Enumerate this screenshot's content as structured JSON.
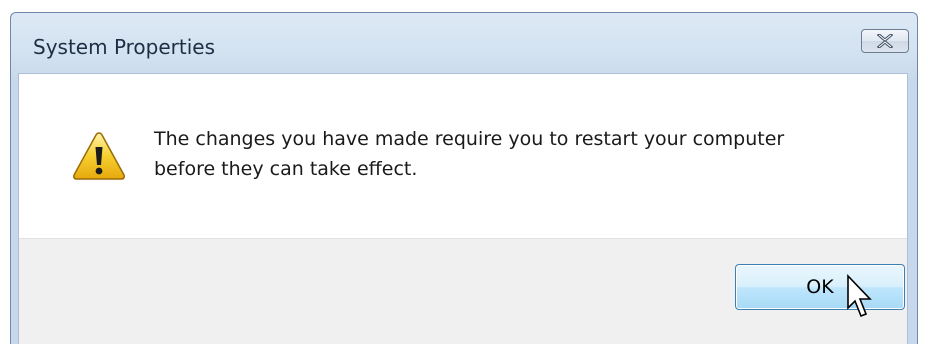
{
  "window": {
    "title": "System Properties",
    "close_icon": "close-icon"
  },
  "message": {
    "icon": "warning-icon",
    "line1": "The changes you have made require you to restart your computer",
    "line2": "before they can take effect."
  },
  "buttons": {
    "ok_label": "OK"
  },
  "colors": {
    "title_bar": "#d3e2f1",
    "button_area": "#f0f0f0",
    "ok_button": "#bee6fd",
    "warning": "#f2c11c"
  },
  "cursor": {
    "icon": "arrow-cursor-icon"
  }
}
